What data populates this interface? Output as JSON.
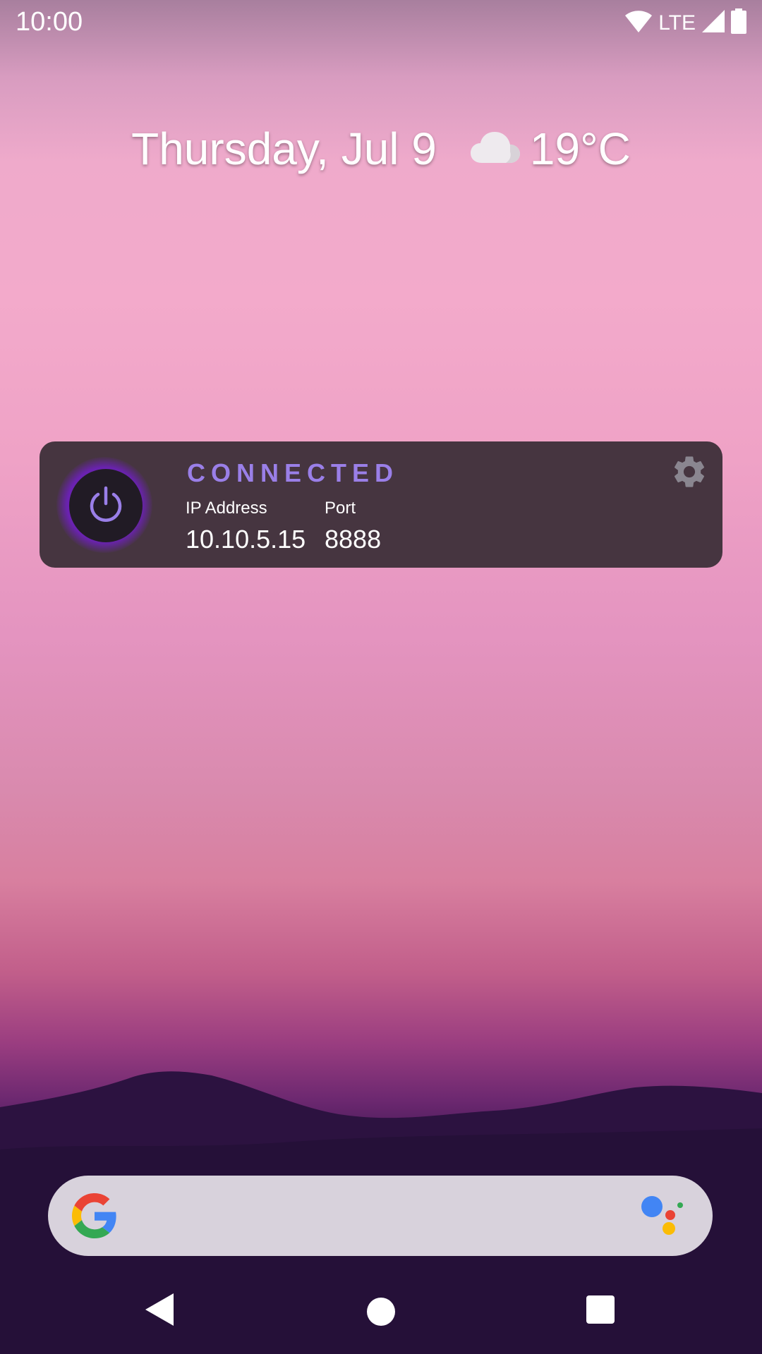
{
  "status_bar": {
    "time": "10:00",
    "network_label": "LTE",
    "icons": [
      "wifi-icon",
      "cell-signal-icon",
      "battery-icon"
    ]
  },
  "glance": {
    "date": "Thursday, Jul 9",
    "weather_icon": "cloud-icon",
    "temperature": "19°C"
  },
  "widget": {
    "status": "CONNECTED",
    "status_color": "#9a7fe8",
    "ip_label": "IP Address",
    "ip_value": "10.10.5.15",
    "port_label": "Port",
    "port_value": "8888",
    "power_icon": "power-icon",
    "settings_icon": "gear-icon"
  },
  "search_bar": {
    "logo": "google-g-icon",
    "assistant_icon": "google-assistant-icon"
  },
  "nav_bar": {
    "icons": [
      "back-icon",
      "home-icon",
      "recents-icon"
    ]
  }
}
